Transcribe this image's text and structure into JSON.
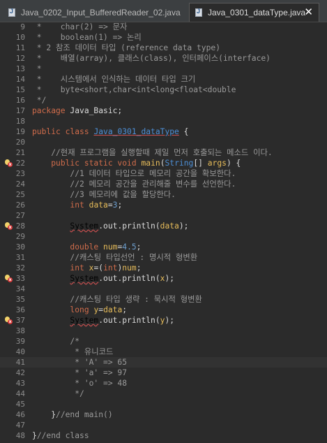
{
  "tabs": [
    {
      "label": "Java_0202_Input_BufferedReader_02.java",
      "active": false
    },
    {
      "label": "Java_0301_dataType.java",
      "active": true
    }
  ],
  "close_glyph": "✕",
  "error_marker_lines": [
    22,
    28,
    33,
    37
  ],
  "highlighted_line": 41,
  "lines": [
    {
      "n": "9",
      "segs": [
        [
          "cmt",
          " *    char(2) => 문자"
        ]
      ]
    },
    {
      "n": "10",
      "segs": [
        [
          "cmt",
          " *    boolean(1) => 논리"
        ]
      ]
    },
    {
      "n": "11",
      "segs": [
        [
          "cmt",
          " * 2 참조 데이터 타입 (reference data type)"
        ]
      ]
    },
    {
      "n": "12",
      "segs": [
        [
          "cmt",
          " *    배열(array), 클래스(class), 인터페이스(interface)"
        ]
      ]
    },
    {
      "n": "13",
      "segs": [
        [
          "cmt",
          " *"
        ]
      ]
    },
    {
      "n": "14",
      "segs": [
        [
          "cmt",
          " *    시스템에서 인식하는 데이터 타입 크기"
        ]
      ]
    },
    {
      "n": "15",
      "segs": [
        [
          "cmt",
          " *    byte<short,char<int<long<float<double"
        ]
      ]
    },
    {
      "n": "16",
      "segs": [
        [
          "cmt",
          " */"
        ]
      ]
    },
    {
      "n": "17",
      "segs": [
        [
          "kw",
          "package"
        ],
        [
          "plain",
          " Java_Basic;"
        ]
      ]
    },
    {
      "n": "18",
      "segs": []
    },
    {
      "n": "19",
      "segs": [
        [
          "kw",
          "public class"
        ],
        [
          "plain",
          " "
        ],
        [
          "cls",
          "Java_0301_dataType"
        ],
        [
          "plain",
          " {"
        ]
      ]
    },
    {
      "n": "20",
      "segs": []
    },
    {
      "n": "21",
      "segs": [
        [
          "cmt",
          "    //현재 프로그램을 실행할때 제일 먼저 호출되는 메소드 이다."
        ]
      ]
    },
    {
      "n": "22",
      "segs": [
        [
          "plain",
          "    "
        ],
        [
          "kw",
          "public static void"
        ],
        [
          "plain",
          " "
        ],
        [
          "fn",
          "main"
        ],
        [
          "plain",
          "("
        ],
        [
          "typ",
          "String"
        ],
        [
          "plain",
          "[] "
        ],
        [
          "var",
          "args"
        ],
        [
          "plain",
          ") {"
        ]
      ]
    },
    {
      "n": "23",
      "segs": [
        [
          "cmt",
          "        //1 데이터 타입으로 메모리 공간을 확보한다."
        ]
      ]
    },
    {
      "n": "24",
      "segs": [
        [
          "cmt",
          "        //2 메모리 공간을 관리해줄 변수를 선언한다."
        ]
      ]
    },
    {
      "n": "25",
      "segs": [
        [
          "cmt",
          "        //3 메모리에 값을 할당한다."
        ]
      ]
    },
    {
      "n": "26",
      "segs": [
        [
          "plain",
          "        "
        ],
        [
          "kw",
          "int"
        ],
        [
          "plain",
          " "
        ],
        [
          "var",
          "data"
        ],
        [
          "plain",
          "="
        ],
        [
          "num",
          "3"
        ],
        [
          "plain",
          ";"
        ]
      ]
    },
    {
      "n": "27",
      "segs": []
    },
    {
      "n": "28",
      "segs": [
        [
          "plain",
          "        "
        ],
        [
          "wav",
          "System"
        ],
        [
          "plain",
          ".out.println("
        ],
        [
          "var",
          "data"
        ],
        [
          "plain",
          ");"
        ]
      ]
    },
    {
      "n": "29",
      "segs": []
    },
    {
      "n": "30",
      "segs": [
        [
          "plain",
          "        "
        ],
        [
          "kw",
          "double"
        ],
        [
          "plain",
          " "
        ],
        [
          "var",
          "num"
        ],
        [
          "plain",
          "="
        ],
        [
          "num",
          "4.5"
        ],
        [
          "plain",
          ";"
        ]
      ]
    },
    {
      "n": "31",
      "segs": [
        [
          "cmt",
          "        //캐스팅 타입선언 : 명시적 형변환"
        ]
      ]
    },
    {
      "n": "32",
      "segs": [
        [
          "plain",
          "        "
        ],
        [
          "kw",
          "int"
        ],
        [
          "plain",
          " "
        ],
        [
          "var",
          "x"
        ],
        [
          "plain",
          "=("
        ],
        [
          "kw",
          "int"
        ],
        [
          "plain",
          ")"
        ],
        [
          "var",
          "num"
        ],
        [
          "plain",
          ";"
        ]
      ]
    },
    {
      "n": "33",
      "segs": [
        [
          "plain",
          "        "
        ],
        [
          "wav",
          "System"
        ],
        [
          "plain",
          ".out.println("
        ],
        [
          "var",
          "x"
        ],
        [
          "plain",
          ");"
        ]
      ]
    },
    {
      "n": "34",
      "segs": []
    },
    {
      "n": "35",
      "segs": [
        [
          "cmt",
          "        //캐스팅 타입 생략 : 묵시적 형변환"
        ]
      ]
    },
    {
      "n": "36",
      "segs": [
        [
          "plain",
          "        "
        ],
        [
          "kw",
          "long"
        ],
        [
          "plain",
          " "
        ],
        [
          "var",
          "y"
        ],
        [
          "plain",
          "="
        ],
        [
          "var",
          "data"
        ],
        [
          "plain",
          ";"
        ]
      ]
    },
    {
      "n": "37",
      "segs": [
        [
          "plain",
          "        "
        ],
        [
          "wav",
          "System"
        ],
        [
          "plain",
          ".out.println("
        ],
        [
          "var",
          "y"
        ],
        [
          "plain",
          ");"
        ]
      ]
    },
    {
      "n": "38",
      "segs": []
    },
    {
      "n": "39",
      "segs": [
        [
          "cmt",
          "        /*"
        ]
      ]
    },
    {
      "n": "40",
      "segs": [
        [
          "cmt",
          "         * 유니코드"
        ]
      ]
    },
    {
      "n": "41",
      "segs": [
        [
          "cmt",
          "         * 'A' => 65"
        ]
      ]
    },
    {
      "n": "42",
      "segs": [
        [
          "cmt",
          "         * 'a' => 97"
        ]
      ]
    },
    {
      "n": "43",
      "segs": [
        [
          "cmt",
          "         * 'o' => 48"
        ]
      ]
    },
    {
      "n": "44",
      "segs": [
        [
          "cmt",
          "         */"
        ]
      ]
    },
    {
      "n": "45",
      "segs": []
    },
    {
      "n": "46",
      "segs": [
        [
          "plain",
          "    }"
        ],
        [
          "cmt",
          "//end main()"
        ]
      ]
    },
    {
      "n": "47",
      "segs": []
    },
    {
      "n": "48",
      "segs": [
        [
          "plain",
          "}"
        ],
        [
          "cmt",
          "//end class"
        ]
      ]
    }
  ]
}
